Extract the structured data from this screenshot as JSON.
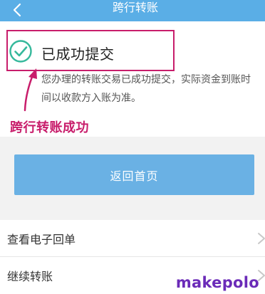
{
  "header": {
    "title": "跨行转账",
    "back_icon": "chevron-left-icon",
    "background": "#5aaee6"
  },
  "result": {
    "status_icon": "check-circle-icon",
    "title": "已成功提交",
    "notice": "您办理的转账交易已成功提交，实际资金到账时间以收款方入账为准。",
    "accent": "#35b89b"
  },
  "annotation": {
    "label": "跨行转账成功",
    "color": "#c81d6b"
  },
  "actions": {
    "return_label": "返回首页",
    "return_color": "#6ab1e4"
  },
  "menu": {
    "items": [
      {
        "label": "查看电子回单"
      },
      {
        "label": "继续转账"
      }
    ]
  },
  "watermark": {
    "text": "makepolo",
    "color": "#6b2bb8"
  }
}
